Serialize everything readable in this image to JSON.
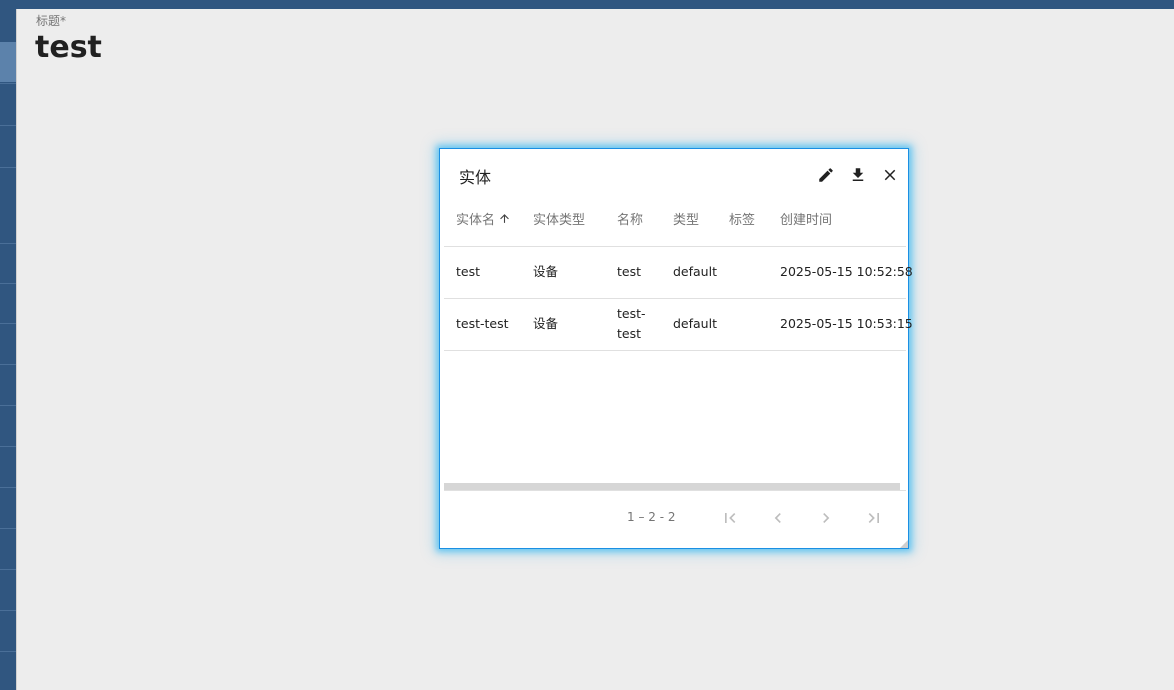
{
  "page": {
    "title_label": "标题*",
    "title_value": "test"
  },
  "widget": {
    "title": "实体",
    "actions": {
      "edit_icon": "pencil-icon",
      "download_icon": "download-icon",
      "close_icon": "close-icon"
    },
    "columns": [
      "实体名",
      "实体类型",
      "名称",
      "类型",
      "标签",
      "创建时间"
    ],
    "sort_column": "实体名",
    "sort_direction": "ascending",
    "rows": [
      {
        "entity_name": "test",
        "entity_type": "设备",
        "name": "test",
        "type": "default",
        "label": "",
        "created": "2025-05-15 10:52:58"
      },
      {
        "entity_name": "test-test",
        "entity_type": "设备",
        "name_line1": "test-",
        "name_line2": "test",
        "type": "default",
        "label": "",
        "created": "2025-05-15 10:53:15"
      }
    ],
    "pagination": {
      "range": "1 – 2 - 2"
    }
  },
  "colors": {
    "nav": "#305680",
    "accent": "#03a9f4"
  }
}
